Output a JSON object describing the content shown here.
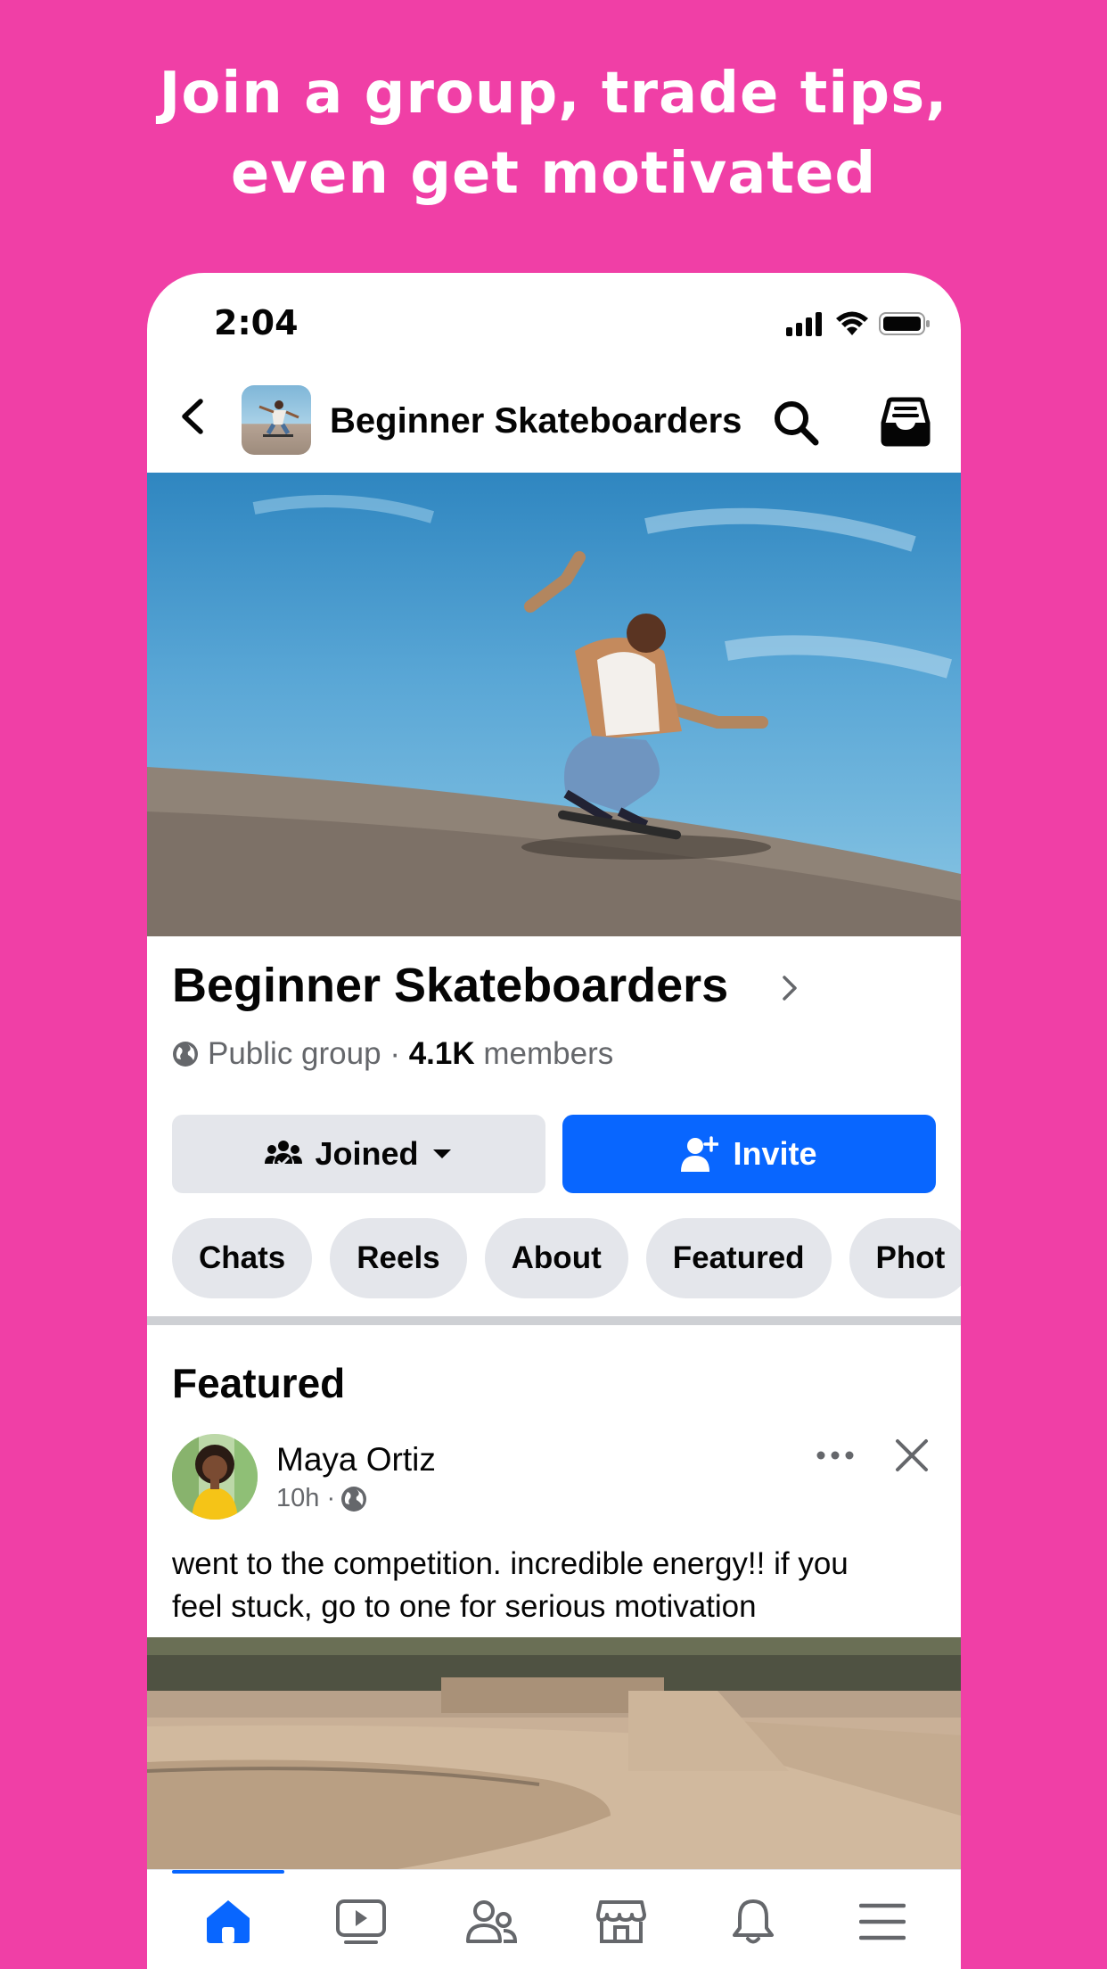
{
  "promo": {
    "line1": "Join a group, trade tips,",
    "line2": "even get motivated"
  },
  "status_bar": {
    "time": "2:04"
  },
  "header": {
    "group_name": "Beginner Skateboarders"
  },
  "group": {
    "title": "Beginner Skateboarders",
    "privacy": "Public group",
    "separator": "·",
    "member_count": "4.1K",
    "members_label": "members"
  },
  "actions": {
    "joined_label": "Joined",
    "invite_label": "Invite"
  },
  "chips": [
    "Chats",
    "Reels",
    "About",
    "Featured",
    "Phot"
  ],
  "featured": {
    "section_title": "Featured",
    "post": {
      "author": "Maya Ortiz",
      "time": "10h ·",
      "text_line1": "went to the competition. incredible energy!! if you",
      "text_line2": "feel stuck, go to one for serious motivation"
    }
  },
  "colors": {
    "background": "#F03FA6",
    "accent": "#0866FF",
    "chip_bg": "#E4E6EB"
  },
  "bottom_nav": [
    "home-icon",
    "video-icon",
    "groups-icon",
    "marketplace-icon",
    "bell-icon",
    "menu-icon"
  ]
}
